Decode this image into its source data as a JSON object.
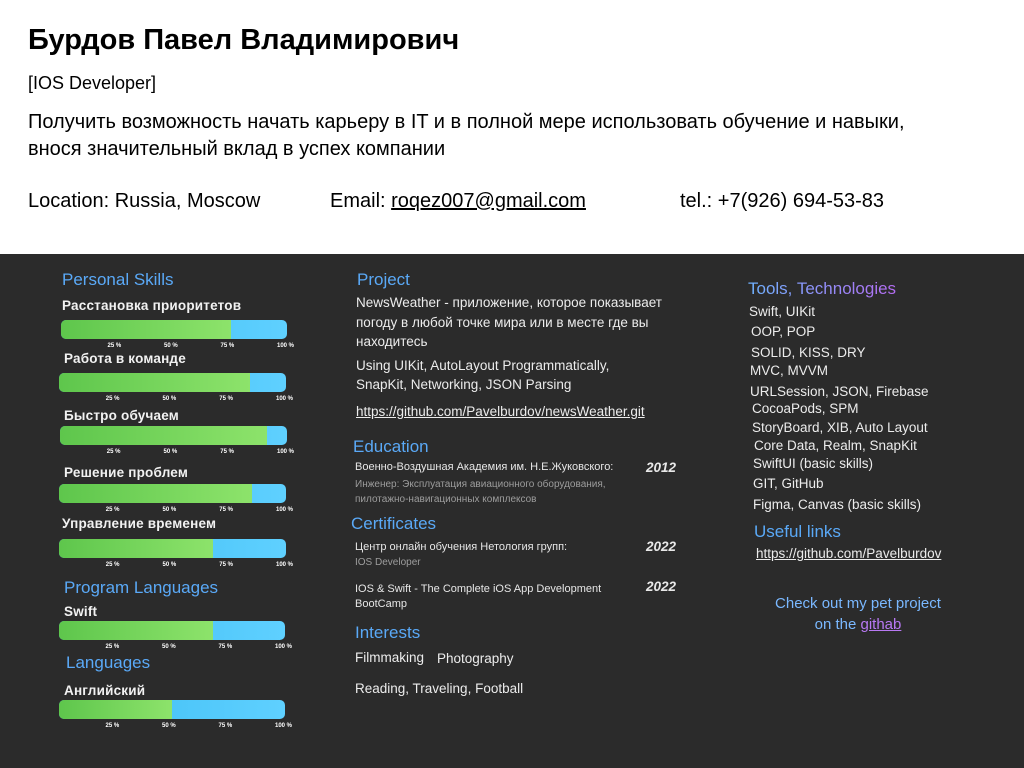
{
  "header": {
    "name": "Бурдов Павел Владимирович",
    "role": "[IOS Developer]",
    "objective": "Получить возможность начать карьеру в IT и в полной мере использовать обучение и навыки, внося значительный вклад в успех компании",
    "location": "Location: Russia, Moscow",
    "email_label": "Email: ",
    "email": "roqez007@gmail.com",
    "phone": "tel.: +7(926) 694-53-83"
  },
  "tick_labels": [
    "25 %",
    "50 %",
    "75 %",
    "100 %"
  ],
  "personal_skills": {
    "heading": "Personal Skills",
    "items": [
      {
        "label": "Расстановка приоритетов",
        "level": 0.75
      },
      {
        "label": "Работа в команде",
        "level": 0.84
      },
      {
        "label": "Быстро обучаем",
        "level": 0.91
      },
      {
        "label": "Решение проблем",
        "level": 0.85
      },
      {
        "label": "Управление временем",
        "level": 0.68
      }
    ]
  },
  "program_languages": {
    "heading": "Program Languages",
    "items": [
      {
        "label": "Swift",
        "level": 0.68
      }
    ]
  },
  "languages": {
    "heading": "Languages",
    "items": [
      {
        "label": "Английский",
        "level": 0.5
      }
    ]
  },
  "project": {
    "heading": "Project",
    "description": [
      "NewsWeather - приложение, которое показывает",
      "погоду в любой точке мира или в месте где вы",
      "находитесь"
    ],
    "stack": [
      "Using UIKit, AutoLayout Programmatically,",
      "SnapKit, Networking, JSON Parsing"
    ],
    "link": "https://github.com/Pavelburdov/newsWeather.git"
  },
  "education": {
    "heading": "Education",
    "school": "Военно-Воздушная Академия им. Н.Е.Жуковского:",
    "year": "2012",
    "details": [
      "Инженер: Эксплуатация авиационного оборудования,",
      "пилотажно-навигационных комплексов"
    ]
  },
  "certificates": {
    "heading": "Certificates",
    "items": [
      {
        "lines": [
          "Центр онлайн обучения Нетология групп:"
        ],
        "sub": "IOS Developer",
        "year": "2022"
      },
      {
        "lines": [
          "IOS & Swift - The Complete iOS App Development",
          "BootCamp"
        ],
        "sub": "",
        "year": "2022"
      }
    ]
  },
  "interests": {
    "heading": "Interests",
    "items": [
      "Filmmaking",
      "Photography",
      "Reading, Traveling, Football"
    ]
  },
  "tools": {
    "heading": "Tools, Technologies",
    "items": [
      "Swift, UIKit",
      "OOP, POP",
      "SOLID, KISS, DRY",
      "MVC, MVVM",
      "URLSession, JSON, Firebase",
      "CocoaPods, SPM",
      "StoryBoard, XIB, Auto Layout",
      "Core Data, Realm, SnapKit",
      "SwiftUI (basic skills)",
      "GIT, GitHub",
      "Figma, Canvas (basic skills)"
    ]
  },
  "useful_links": {
    "heading": "Useful links",
    "items": [
      "https://github.com/Pavelburdov"
    ]
  },
  "pet_project": {
    "line1": "Check out my pet project",
    "line2_prefix": "on the ",
    "line2_link": "githab"
  },
  "colors": {
    "bar_green": "#5ec64c",
    "bar_blue": "#3bbcf2",
    "dark_background": "#2b2b2b",
    "heading_blue": "#5aa9f7",
    "heading_violet": "#b46cf2"
  }
}
